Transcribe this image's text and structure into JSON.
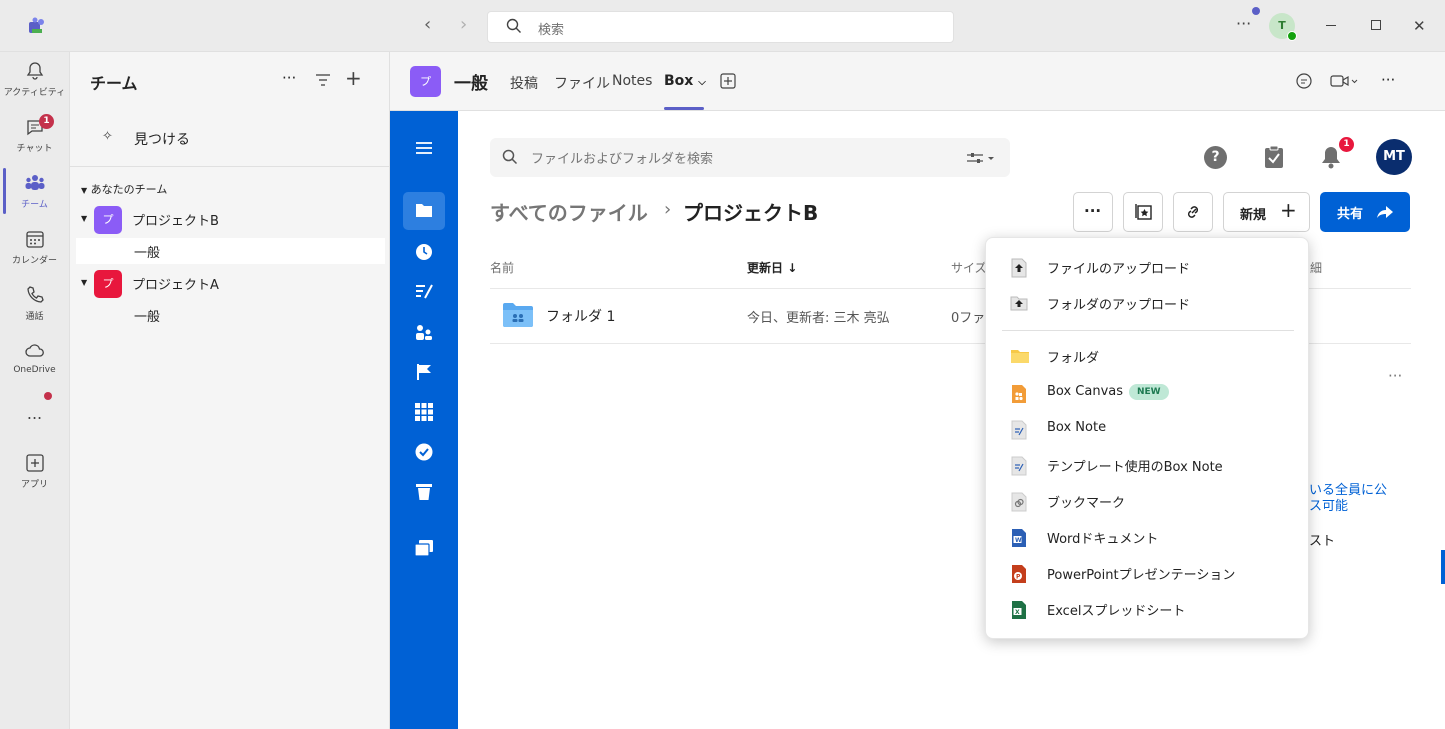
{
  "titlebar": {
    "search_placeholder": "検索",
    "avatar_initial": "T"
  },
  "rail": {
    "items": [
      {
        "label": "アクティビティ"
      },
      {
        "label": "チャット",
        "badge": "1"
      },
      {
        "label": "チーム"
      },
      {
        "label": "カレンダー"
      },
      {
        "label": "通話"
      },
      {
        "label": "OneDrive"
      },
      {
        "label": "..."
      },
      {
        "label": "アプリ"
      }
    ]
  },
  "teams_panel": {
    "title": "チーム",
    "discover": "見つける",
    "section": "あなたのチーム",
    "teams": [
      {
        "name": "プロジェクトB",
        "avatar": "プ",
        "color": "#8b5cf6",
        "channel": "一般"
      },
      {
        "name": "プロジェクトA",
        "avatar": "プ",
        "color": "#e8173d",
        "channel": "一般"
      }
    ]
  },
  "channel_header": {
    "avatar": "プ",
    "title": "一般",
    "tabs": [
      "投稿",
      "ファイル",
      "Notes",
      "Box"
    ]
  },
  "box": {
    "search_placeholder": "ファイルおよびフォルダを検索",
    "notification_count": "1",
    "user_initials": "MT",
    "breadcrumb_root": "すべてのファイル",
    "breadcrumb_current": "プロジェクトB",
    "new_label": "新規",
    "share_label": "共有",
    "columns": {
      "name": "名前",
      "updated": "更新日",
      "size": "サイズ",
      "details": "細"
    },
    "rows": [
      {
        "name": "フォルダ 1",
        "updated": "今日、更新者: 三木 亮弘",
        "size": "0ファ"
      }
    ],
    "side_text_1": "いる全員に公",
    "side_text_2": "ス可能",
    "side_text_3": "スト"
  },
  "menu": {
    "items": [
      {
        "label": "ファイルのアップロード",
        "icon": "upload-file-icon"
      },
      {
        "label": "フォルダのアップロード",
        "icon": "upload-folder-icon"
      },
      {
        "label": "フォルダ",
        "icon": "folder-icon"
      },
      {
        "label": "Box Canvas",
        "icon": "box-canvas-icon",
        "badge": "NEW"
      },
      {
        "label": "Box Note",
        "icon": "box-note-icon"
      },
      {
        "label": "テンプレート使用のBox Note",
        "icon": "box-note-template-icon"
      },
      {
        "label": "ブックマーク",
        "icon": "bookmark-icon"
      },
      {
        "label": "Wordドキュメント",
        "icon": "word-icon"
      },
      {
        "label": "PowerPointプレゼンテーション",
        "icon": "powerpoint-icon"
      },
      {
        "label": "Excelスプレッドシート",
        "icon": "excel-icon"
      }
    ]
  },
  "colors": {
    "box_blue": "#0061d5",
    "teams_purple": "#5b5fc7",
    "badge_red": "#c4314b"
  }
}
